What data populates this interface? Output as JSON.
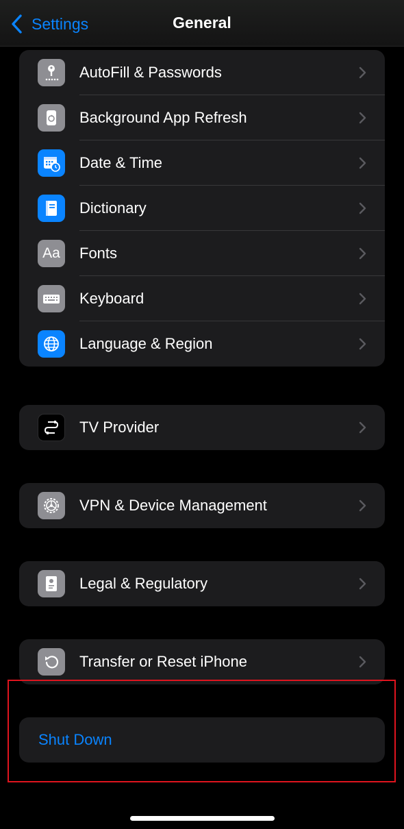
{
  "nav": {
    "back_label": "Settings",
    "title": "General"
  },
  "groups": [
    {
      "items": [
        {
          "label": "AutoFill & Passwords",
          "icon": "key-icon",
          "icon_color": "#8e8e93"
        },
        {
          "label": "Background App Refresh",
          "icon": "app-refresh-icon",
          "icon_color": "#8e8e93"
        },
        {
          "label": "Date & Time",
          "icon": "calendar-clock-icon",
          "icon_color": "#0a84ff"
        },
        {
          "label": "Dictionary",
          "icon": "book-icon",
          "icon_color": "#0a84ff"
        },
        {
          "label": "Fonts",
          "icon": "fonts-icon",
          "icon_color": "#8e8e93",
          "icon_text": "Aa"
        },
        {
          "label": "Keyboard",
          "icon": "keyboard-icon",
          "icon_color": "#8e8e93"
        },
        {
          "label": "Language & Region",
          "icon": "globe-icon",
          "icon_color": "#0a84ff"
        }
      ]
    },
    {
      "items": [
        {
          "label": "TV Provider",
          "icon": "tv-provider-icon",
          "icon_color": "#000000"
        }
      ]
    },
    {
      "items": [
        {
          "label": "VPN & Device Management",
          "icon": "gear-icon",
          "icon_color": "#8e8e93"
        }
      ]
    },
    {
      "items": [
        {
          "label": "Legal & Regulatory",
          "icon": "document-icon",
          "icon_color": "#8e8e93"
        }
      ]
    },
    {
      "items": [
        {
          "label": "Transfer or Reset iPhone",
          "icon": "reset-icon",
          "icon_color": "#8e8e93"
        }
      ]
    }
  ],
  "shutdown": {
    "label": "Shut Down"
  },
  "colors": {
    "accent": "#0a84ff",
    "background": "#000000",
    "cell": "#1c1c1e",
    "highlight": "#e0141e"
  }
}
